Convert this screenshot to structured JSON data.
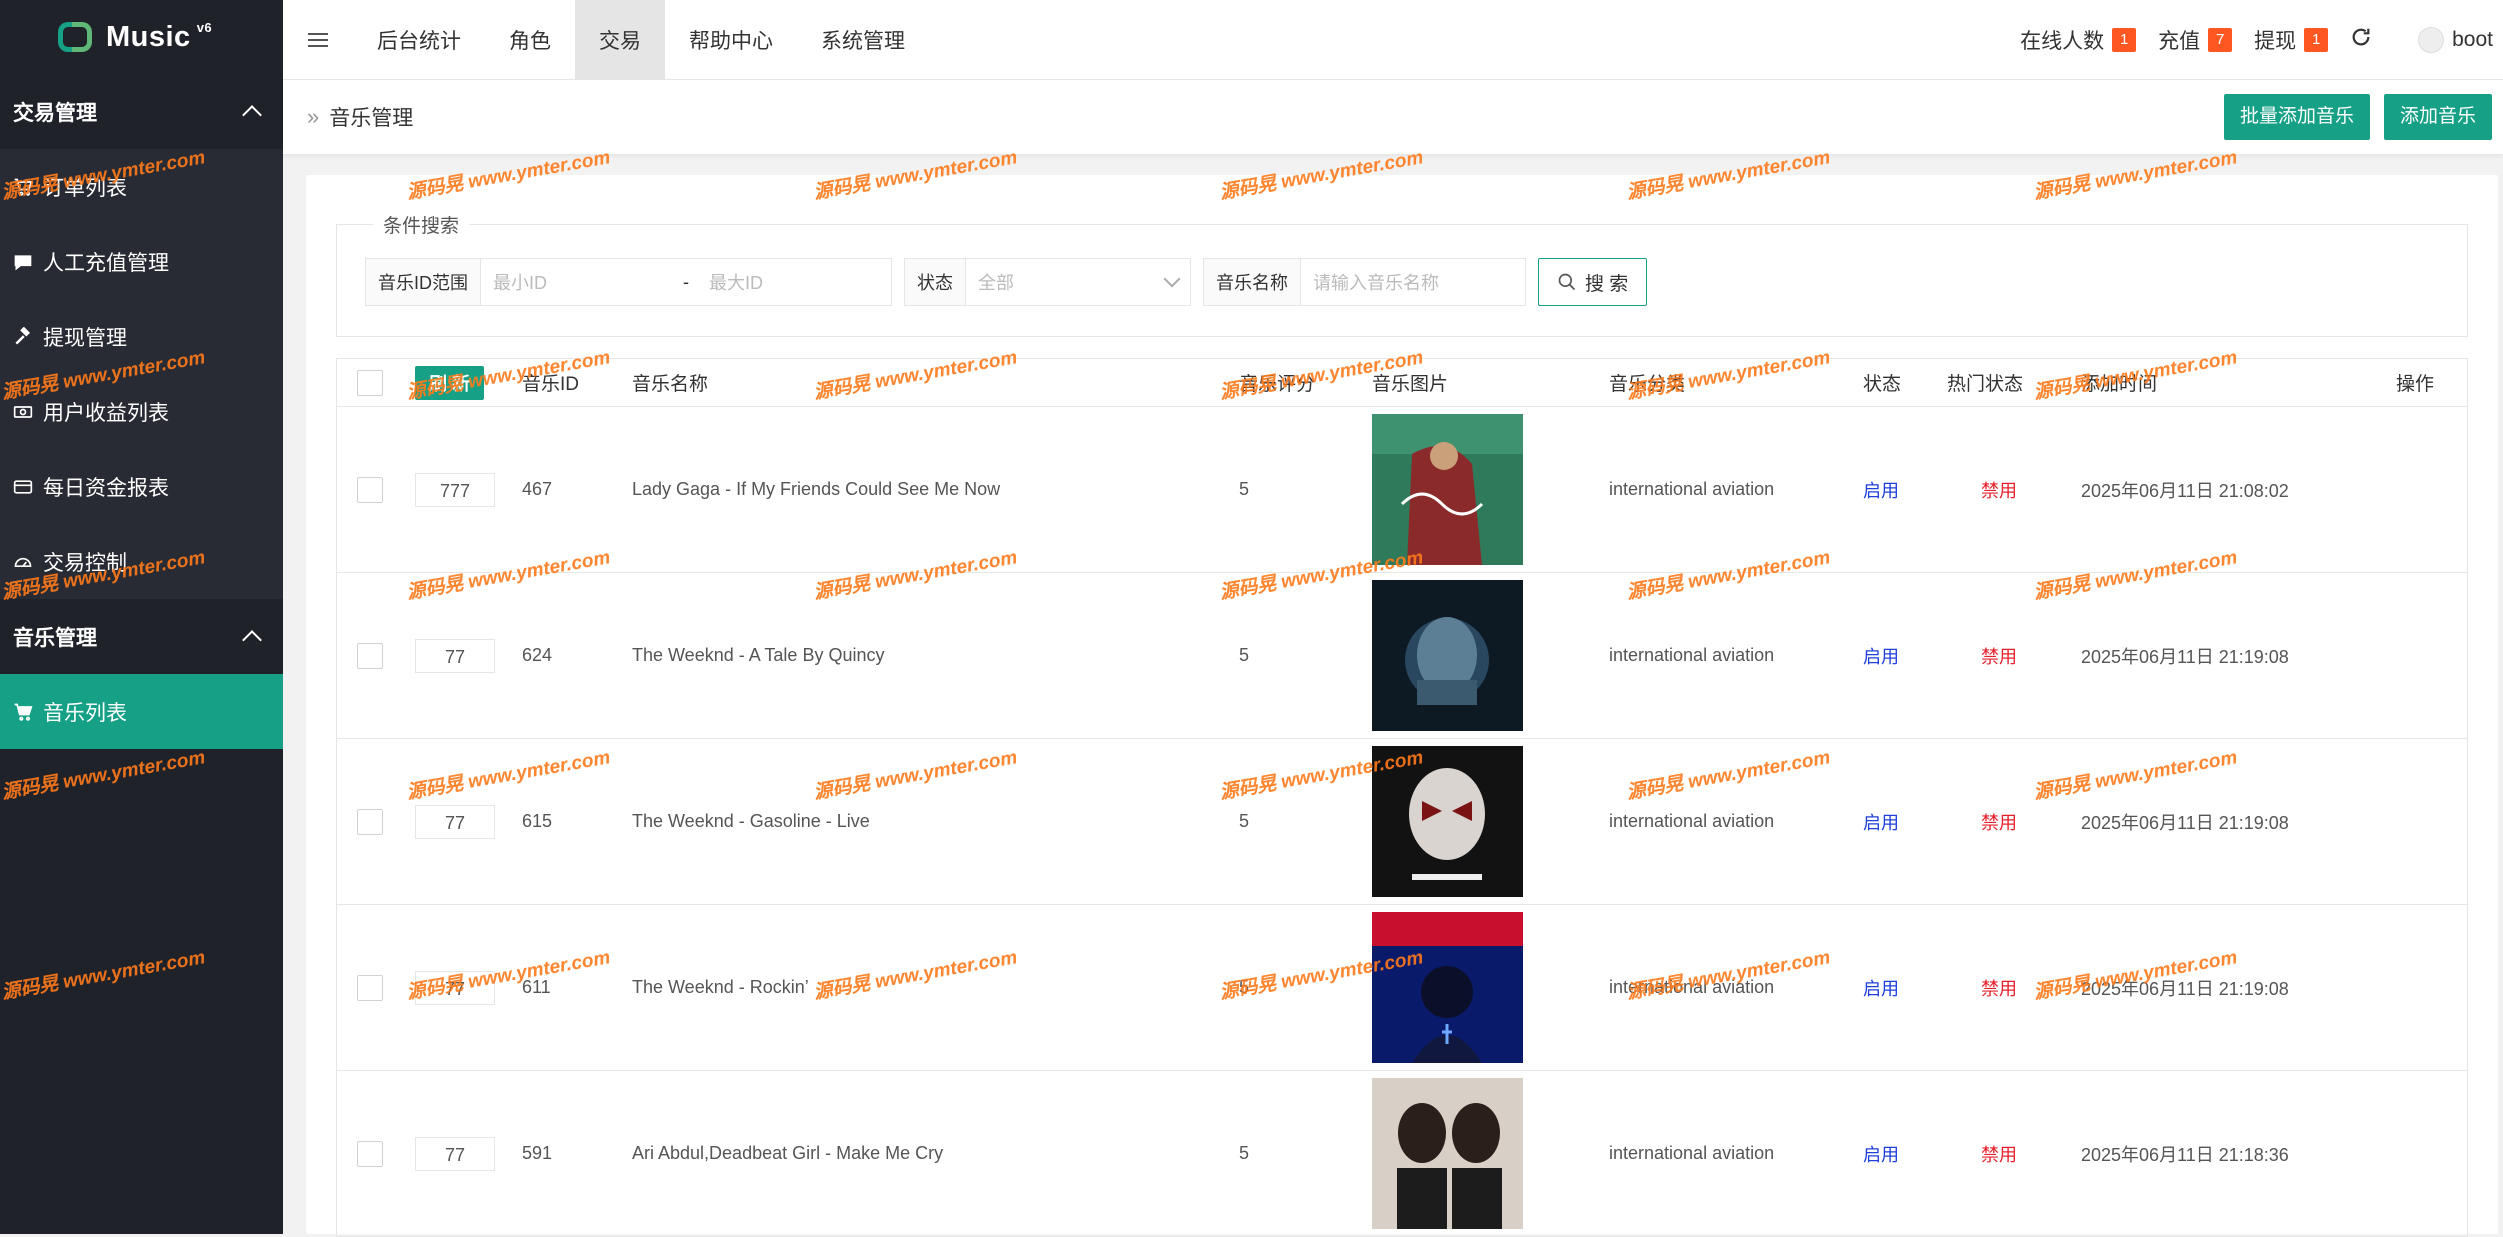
{
  "app": {
    "logo_text": "Music",
    "logo_version": "v6"
  },
  "sidebar": {
    "groups": [
      {
        "label": "交易管理",
        "items": [
          {
            "label": "订单列表",
            "icon": "cart-icon"
          },
          {
            "label": "人工充值管理",
            "icon": "chat-icon"
          },
          {
            "label": "提现管理",
            "icon": "hammer-icon"
          },
          {
            "label": "用户收益列表",
            "icon": "money-icon"
          },
          {
            "label": "每日资金报表",
            "icon": "card-icon"
          },
          {
            "label": "交易控制",
            "icon": "gauge-icon"
          }
        ]
      },
      {
        "label": "音乐管理",
        "items": [
          {
            "label": "音乐列表",
            "icon": "cart-icon",
            "active": true
          }
        ]
      }
    ]
  },
  "topbar": {
    "tabs": [
      "后台统计",
      "角色",
      "交易",
      "帮助中心",
      "系统管理"
    ],
    "active_tab": "交易",
    "online_label": "在线人数",
    "online_count": "1",
    "recharge_label": "充值",
    "recharge_count": "7",
    "withdraw_label": "提现",
    "withdraw_count": "1",
    "user": "boot"
  },
  "breadcrumb": {
    "title": "音乐管理"
  },
  "actions": {
    "batch_add": "批量添加音乐",
    "add": "添加音乐"
  },
  "search": {
    "legend": "条件搜索",
    "id_range_label": "音乐ID范围",
    "min_id_placeholder": "最小ID",
    "max_id_placeholder": "最大ID",
    "dash": "-",
    "status_label": "状态",
    "status_value": "全部",
    "name_label": "音乐名称",
    "name_placeholder": "请输入音乐名称",
    "search_button": "搜 索"
  },
  "table": {
    "refresh_label": "刷 新",
    "headers": [
      "音乐ID",
      "音乐名称",
      "音乐评分",
      "音乐图片",
      "音乐分类",
      "状态",
      "热门状态",
      "添加时间",
      "操作"
    ],
    "rows": [
      {
        "sort": "777",
        "id": "467",
        "name": "Lady Gaga - If My Friends Could See Me Now",
        "rating": "5",
        "category": "international aviation",
        "status": "启用",
        "hot": "禁用",
        "time": "2025年06月11日 21:08:02"
      },
      {
        "sort": "77",
        "id": "624",
        "name": "The Weeknd - A Tale By Quincy",
        "rating": "5",
        "category": "international aviation",
        "status": "启用",
        "hot": "禁用",
        "time": "2025年06月11日 21:19:08"
      },
      {
        "sort": "77",
        "id": "615",
        "name": "The Weeknd - Gasoline - Live",
        "rating": "5",
        "category": "international aviation",
        "status": "启用",
        "hot": "禁用",
        "time": "2025年06月11日 21:19:08"
      },
      {
        "sort": "77",
        "id": "611",
        "name": "The Weeknd - Rockin’",
        "rating": "5",
        "category": "international aviation",
        "status": "启用",
        "hot": "禁用",
        "time": "2025年06月11日 21:19:08"
      },
      {
        "sort": "77",
        "id": "591",
        "name": "Ari Abdul,Deadbeat Girl - Make Me Cry",
        "rating": "5",
        "category": "international aviation",
        "status": "启用",
        "hot": "禁用",
        "time": "2025年06月11日 21:18:36"
      }
    ]
  },
  "watermark": {
    "text": "源码晃 www.ymter.com"
  },
  "colors": {
    "accent": "#16a085",
    "sidebar": "#20222a",
    "badge": "#ff5722",
    "enabled": "#1e3fdc",
    "disabled": "#e6202b"
  }
}
